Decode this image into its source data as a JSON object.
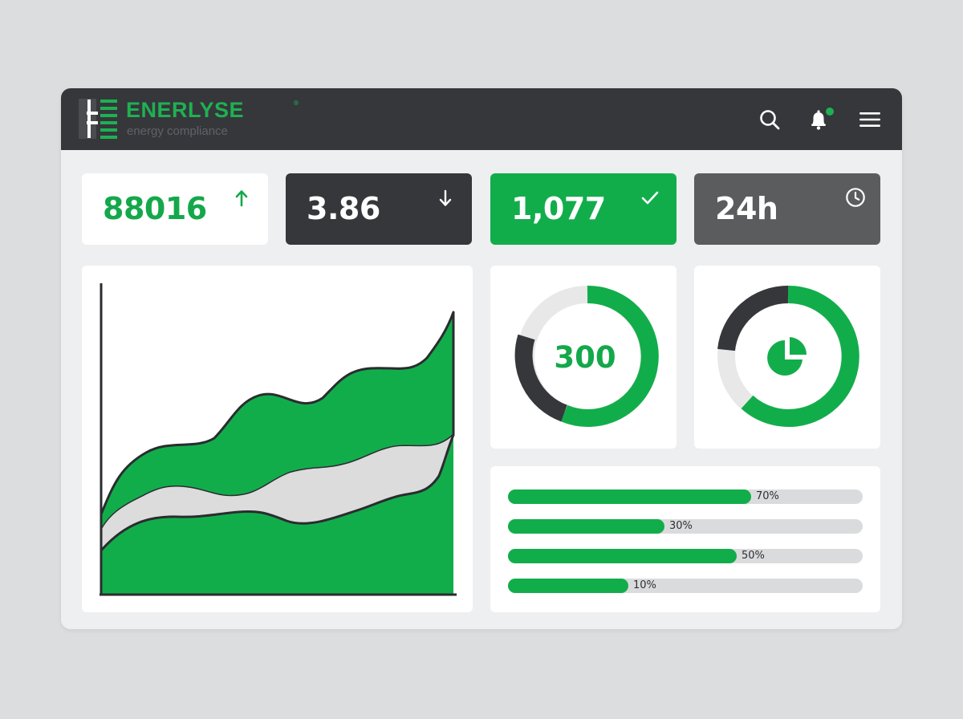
{
  "app": {
    "name": "ENERLYSE",
    "tagline": "energy compliance",
    "registered": "®"
  },
  "topbar": {
    "icons": [
      "search-icon",
      "bell-icon",
      "menu-icon"
    ],
    "notification_dot_color": "#1fb052"
  },
  "stats": [
    {
      "value": "88016",
      "icon": "arrow-up-icon",
      "theme": "light"
    },
    {
      "value": "3.86",
      "icon": "arrow-down-icon",
      "theme": "dark"
    },
    {
      "value": "1,077",
      "icon": "check-icon",
      "theme": "green"
    },
    {
      "value": "24h",
      "icon": "clock-icon",
      "theme": "gray"
    }
  ],
  "area_chart": {
    "type": "area",
    "colors": {
      "top_series": "#12ad4b",
      "middle_band": "#dcdcdc",
      "bottom_series": "#12ad4b"
    }
  },
  "donuts": [
    {
      "center_text": "300",
      "segments": [
        {
          "color": "#12ad4b",
          "fraction": 0.62
        },
        {
          "color": "#35373b",
          "fraction": 0.18
        },
        {
          "color": "#e8e8e8",
          "fraction": 0.2
        }
      ]
    },
    {
      "center_icon": "pie-chart-icon",
      "segments": [
        {
          "color": "#12ad4b",
          "fraction": 0.6
        },
        {
          "color": "#35373b",
          "fraction": 0.22
        },
        {
          "color": "#e8e8e8",
          "fraction": 0.18
        }
      ]
    }
  ],
  "progress_bars": [
    {
      "label": "70%",
      "value": 0.7
    },
    {
      "label": "30%",
      "value": 0.3
    },
    {
      "label": "50%",
      "value": 0.5
    },
    {
      "label": "10%",
      "value": 0.1
    }
  ],
  "colors": {
    "accent": "#12ad4b",
    "dark": "#35373b",
    "gray": "#5b5c5e",
    "panel": "#ffffff",
    "window": "#eeeff0"
  }
}
